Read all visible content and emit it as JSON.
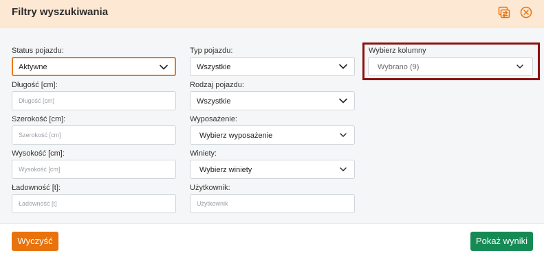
{
  "header": {
    "title": "Filtry wyszukiwania",
    "icons": [
      "swap-icon",
      "close-icon"
    ],
    "accent_color": "#e8720c"
  },
  "filters": {
    "status": {
      "label": "Status pojazdu:",
      "value": "Aktywne"
    },
    "typ": {
      "label": "Typ pojazdu:",
      "value": "Wszystkie"
    },
    "dlugosc": {
      "label": "Długość [cm]:",
      "placeholder": "Długość [cm]"
    },
    "rodzaj": {
      "label": "Rodzaj pojazdu:",
      "value": "Wszystkie"
    },
    "szerokosc": {
      "label": "Szerokość [cm]:",
      "placeholder": "Szerokość [cm]"
    },
    "wyposazenie": {
      "label": "Wyposażenie:",
      "value": "Wybierz wyposażenie"
    },
    "wysokosc": {
      "label": "Wysokość [cm]:",
      "placeholder": "Wysokość [cm]"
    },
    "winiety": {
      "label": "Winiety:",
      "value": "Wybierz winiety"
    },
    "ladownosc": {
      "label": "Ładowność [t]:",
      "placeholder": "Ładowność [t]"
    },
    "uzytkownik": {
      "label": "Użytkownik:",
      "placeholder": "Użytkownik"
    },
    "kolumny": {
      "label": "Wybierz kolumny",
      "value": "Wybrano (9)"
    }
  },
  "footer": {
    "clear_label": "Wyczyść",
    "show_label": "Pokaż wyniki",
    "clear_color": "#e8720c",
    "show_color": "#168a55"
  }
}
